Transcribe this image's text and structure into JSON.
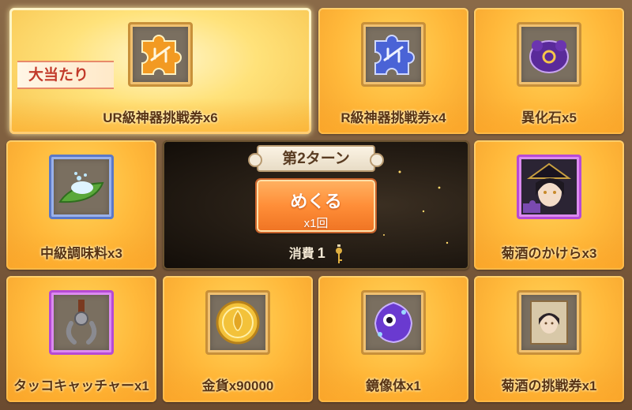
{
  "jackpot_badge": "大当たり",
  "turn_label": "第2ターン",
  "flip_button": {
    "main": "めくる",
    "sub": "x1回"
  },
  "cost": {
    "label": "消費",
    "value": "1",
    "icon": "key-icon"
  },
  "tiles": [
    {
      "name": "UR級神器挑戦券x6",
      "icon": "gold-puzzle-piece-icon",
      "frame": "gold"
    },
    {
      "name": "R級神器挑戦券x4",
      "icon": "blue-puzzle-piece-icon",
      "frame": "gold"
    },
    {
      "name": "異化石x5",
      "icon": "purple-crystal-icon",
      "frame": "gold"
    },
    {
      "name": "中級調味料x3",
      "icon": "seasoning-leaf-icon",
      "frame": "blue"
    },
    {
      "name": "菊酒のかけらx3",
      "icon": "character-fragment-icon",
      "frame": "purple"
    },
    {
      "name": "タッコキャッチャーx1",
      "icon": "claw-catcher-icon",
      "frame": "purple"
    },
    {
      "name": "金貨x90000",
      "icon": "gold-coin-icon",
      "frame": "gold"
    },
    {
      "name": "鏡像体x1",
      "icon": "mirror-slime-icon",
      "frame": "gold"
    },
    {
      "name": "菊酒の挑戦券x1",
      "icon": "portrait-ticket-icon",
      "frame": "gold"
    }
  ],
  "colors": {
    "tile": "#ffb83a",
    "label": "#5a3414",
    "button": "#ff8e38",
    "badge_text": "#c23a2a"
  }
}
